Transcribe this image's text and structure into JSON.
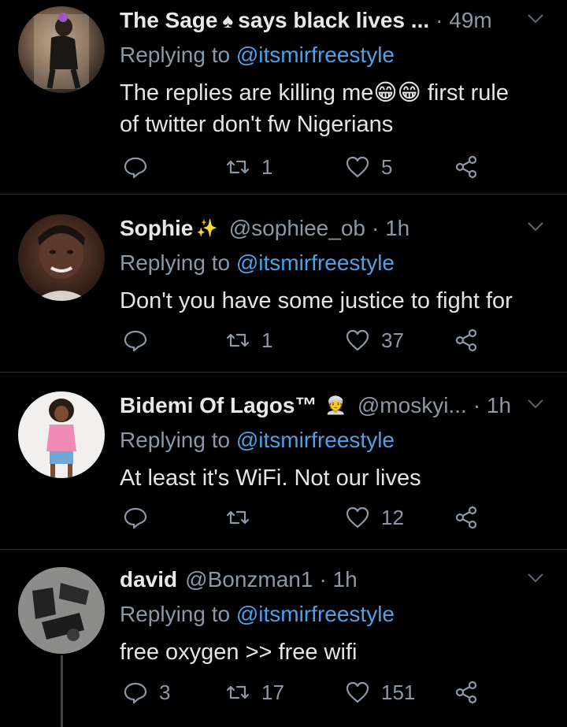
{
  "tweets": [
    {
      "name": "The Sage",
      "name_suffix": "says black lives ...",
      "handle": "",
      "time": "· 49m",
      "reply_prefix": "Replying to",
      "reply_mention": "@itsmirfreestyle",
      "text_line1": "The replies are killing me😁😁 first rule",
      "text_line2": "of twitter don't fw Nigerians",
      "replies": "",
      "retweets": "1",
      "likes": "5"
    },
    {
      "name": "Sophie",
      "handle": "@sophiee_ob",
      "time": "· 1h",
      "reply_prefix": "Replying to",
      "reply_mention": "@itsmirfreestyle",
      "text_line1": "Don't you have some justice to fight for",
      "replies": "",
      "retweets": "1",
      "likes": "37"
    },
    {
      "name": "Bidemi Of Lagos™",
      "handle": "@moskyi...",
      "time": "· 1h",
      "reply_prefix": "Replying to",
      "reply_mention": "@itsmirfreestyle",
      "text_line1": "At least it's WiFi. Not our lives",
      "replies": "",
      "retweets": "",
      "likes": "12"
    },
    {
      "name": "david",
      "handle": "@Bonzman1",
      "time": "· 1h",
      "reply_prefix": "Replying to",
      "reply_mention": "@itsmirfreestyle",
      "text_line1": "free oxygen >> free wifi",
      "replies": "3",
      "retweets": "17",
      "likes": "151"
    }
  ],
  "colors": {
    "background": "#000000",
    "mention": "#4aa2ea",
    "muted": "#8b98a5",
    "divider": "#2f3336"
  },
  "icons": [
    "reply-icon",
    "retweet-icon",
    "like-icon",
    "share-icon",
    "chevron-down-icon",
    "spade-icon",
    "sparkles-icon",
    "person-turban-icon"
  ]
}
